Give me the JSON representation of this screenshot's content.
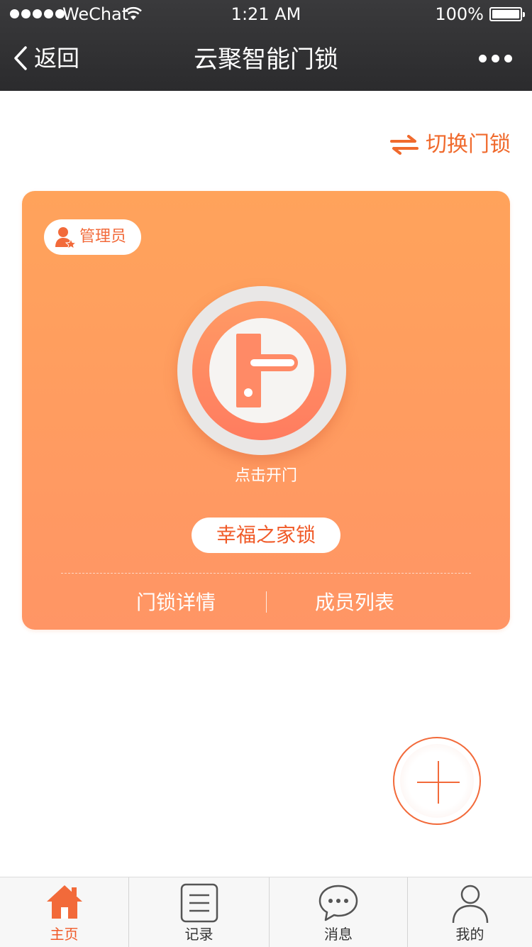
{
  "status_bar": {
    "carrier": "WeChat",
    "time": "1:21 AM",
    "battery": "100%"
  },
  "nav": {
    "back_label": "返回",
    "title": "云聚智能门锁"
  },
  "switch_lock": {
    "label": "切换门锁",
    "icon": "swap-arrows-icon"
  },
  "lock_card": {
    "role": "管理员",
    "unlock_hint": "点击开门",
    "lock_name": "幸福之家锁",
    "actions": {
      "details": "门锁详情",
      "members": "成员列表"
    }
  },
  "tab_bar": {
    "tabs": [
      {
        "label": "主页",
        "icon": "home-icon",
        "active": true
      },
      {
        "label": "记录",
        "icon": "records-icon",
        "active": false
      },
      {
        "label": "消息",
        "icon": "message-icon",
        "active": false
      },
      {
        "label": "我的",
        "icon": "user-icon",
        "active": false
      }
    ]
  },
  "colors": {
    "accent": "#f05a28",
    "card_top": "#ffa35b",
    "card_bottom": "#ff9565",
    "header": "#2f2f31"
  }
}
